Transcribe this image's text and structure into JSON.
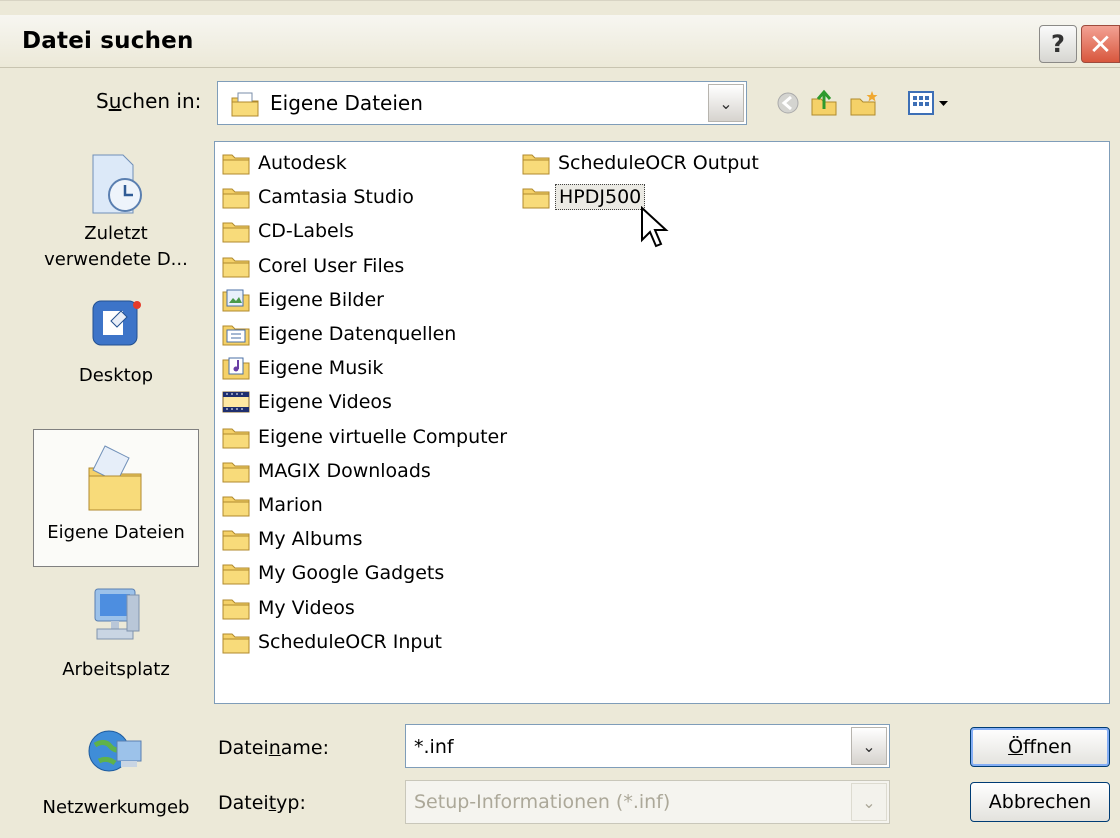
{
  "window": {
    "title": "Datei suchen",
    "help_label": "?",
    "close_label": "✕"
  },
  "lookin": {
    "label_pre": "S",
    "label_accel": "u",
    "label_post": "chen in:",
    "value": "Eigene Dateien"
  },
  "toolbar": {
    "icons": [
      "back-icon",
      "up-folder-icon",
      "new-folder-icon",
      "view-menu-icon"
    ]
  },
  "places": [
    {
      "label": "Zuletzt verwendete D...",
      "icon": "recent-documents-icon"
    },
    {
      "label": "Desktop",
      "icon": "desktop-icon"
    },
    {
      "label": "Eigene Dateien",
      "icon": "my-documents-icon",
      "selected": true
    },
    {
      "label": "Arbeitsplatz",
      "icon": "my-computer-icon"
    },
    {
      "label": "Netzwerkumgeb",
      "icon": "network-icon"
    }
  ],
  "files": [
    {
      "name": "Autodesk",
      "icon": "folder-icon"
    },
    {
      "name": "Camtasia Studio",
      "icon": "folder-icon"
    },
    {
      "name": "CD-Labels",
      "icon": "folder-icon"
    },
    {
      "name": "Corel User Files",
      "icon": "folder-icon"
    },
    {
      "name": "Eigene Bilder",
      "icon": "pictures-folder-icon"
    },
    {
      "name": "Eigene Datenquellen",
      "icon": "datasource-folder-icon"
    },
    {
      "name": "Eigene Musik",
      "icon": "music-folder-icon"
    },
    {
      "name": "Eigene Videos",
      "icon": "video-folder-icon"
    },
    {
      "name": "Eigene virtuelle Computer",
      "icon": "folder-icon"
    },
    {
      "name": "MAGIX Downloads",
      "icon": "folder-icon"
    },
    {
      "name": "Marion",
      "icon": "folder-icon"
    },
    {
      "name": "My Albums",
      "icon": "folder-icon"
    },
    {
      "name": "My Google Gadgets",
      "icon": "folder-icon"
    },
    {
      "name": "My Videos",
      "icon": "folder-icon"
    },
    {
      "name": "ScheduleOCR Input",
      "icon": "folder-icon"
    },
    {
      "name": "ScheduleOCR Output",
      "icon": "folder-icon"
    },
    {
      "name": "HPDJ500",
      "icon": "folder-icon",
      "selected": true
    }
  ],
  "filename": {
    "label_pre": "Datei",
    "label_accel": "n",
    "label_post": "ame:",
    "value": "*.inf"
  },
  "filetype": {
    "label_pre": "Datei",
    "label_accel": "t",
    "label_post": "yp:",
    "value": "Setup-Informationen (*.inf)"
  },
  "buttons": {
    "open_accel": "Ö",
    "open_rest": "ffnen",
    "cancel": "Abbrechen"
  },
  "colors": {
    "folder": "#f5d168",
    "selection": "#ebeae4",
    "close": "#d8573d"
  }
}
